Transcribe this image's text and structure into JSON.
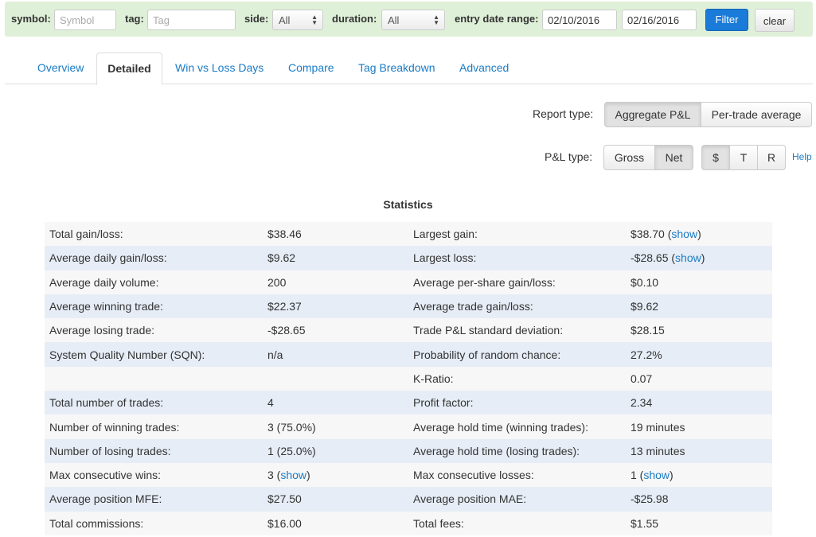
{
  "filters": {
    "symbol_label": "symbol:",
    "symbol_placeholder": "Symbol",
    "tag_label": "tag:",
    "tag_placeholder": "Tag",
    "side_label": "side:",
    "side_value": "All",
    "duration_label": "duration:",
    "duration_value": "All",
    "entry_date_label": "entry date range:",
    "date_from": "02/10/2016",
    "date_to": "02/16/2016",
    "filter_button": "Filter",
    "clear_button": "clear"
  },
  "tabs": [
    "Overview",
    "Detailed",
    "Win vs Loss Days",
    "Compare",
    "Tag Breakdown",
    "Advanced"
  ],
  "active_tab": "Detailed",
  "report_type": {
    "label": "Report type:",
    "options": [
      "Aggregate P&L",
      "Per-trade average"
    ],
    "selected": "Aggregate P&L"
  },
  "pl_type": {
    "label": "P&L type:",
    "options": [
      "Gross",
      "Net"
    ],
    "selected": "Net",
    "unit_options": [
      "$",
      "T",
      "R"
    ],
    "unit_selected": "$",
    "help": "Help"
  },
  "statistics": {
    "title": "Statistics",
    "show_text": "show",
    "rows": [
      {
        "l1": "Total gain/loss:",
        "v1": "$38.46",
        "l2": "Largest gain:",
        "v2": "$38.70",
        "v2_show": true
      },
      {
        "l1": "Average daily gain/loss:",
        "v1": "$9.62",
        "l2": "Largest loss:",
        "v2": "-$28.65",
        "v2_show": true
      },
      {
        "l1": "Average daily volume:",
        "v1": "200",
        "l2": "Average per-share gain/loss:",
        "v2": "$0.10"
      },
      {
        "l1": "Average winning trade:",
        "v1": "$22.37",
        "l2": "Average trade gain/loss:",
        "v2": "$9.62"
      },
      {
        "l1": "Average losing trade:",
        "v1": "-$28.65",
        "l2": "Trade P&L standard deviation:",
        "v2": "$28.15"
      },
      {
        "l1": "System Quality Number (SQN):",
        "v1": "n/a",
        "l2": "Probability of random chance:",
        "v2": "27.2%"
      },
      {
        "l1": "",
        "v1": "",
        "l2": "K-Ratio:",
        "v2": "0.07"
      },
      {
        "l1": "Total number of trades:",
        "v1": "4",
        "l2": "Profit factor:",
        "v2": "2.34"
      },
      {
        "l1": "Number of winning trades:",
        "v1": "3 (75.0%)",
        "l2": "Average hold time (winning trades):",
        "v2": "19 minutes"
      },
      {
        "l1": "Number of losing trades:",
        "v1": "1 (25.0%)",
        "l2": "Average hold time (losing trades):",
        "v2": "13 minutes"
      },
      {
        "l1": "Max consecutive wins:",
        "v1": "3",
        "v1_show": true,
        "l2": "Max consecutive losses:",
        "v2": "1",
        "v2_show": true
      },
      {
        "l1": "Average position MFE:",
        "v1": "$27.50",
        "l2": "Average position MAE:",
        "v2": "-$25.98"
      },
      {
        "l1": "Total commissions:",
        "v1": "$16.00",
        "l2": "Total fees:",
        "v2": "$1.55"
      }
    ]
  }
}
